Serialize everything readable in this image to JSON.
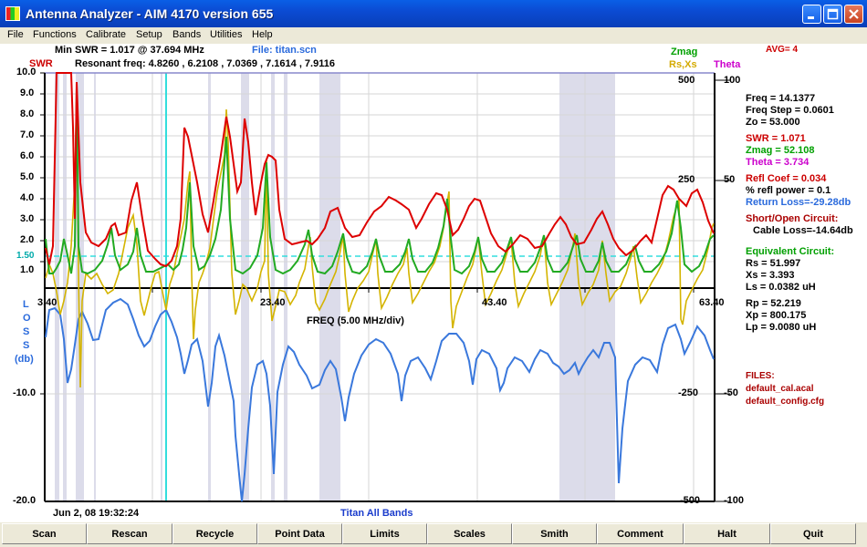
{
  "window": {
    "title": "Antenna Analyzer  -   AIM 4170 version 655"
  },
  "menu": [
    "File",
    "Functions",
    "Calibrate",
    "Setup",
    "Bands",
    "Utilities",
    "Help"
  ],
  "header": {
    "min_swr": "Min SWR =  1.017 @  37.694 MHz",
    "file": "File: titan.scn",
    "resonant": "Resonant freq:  4.8260 , 6.2108 , 7.0369 , 7.1614 , 7.9116",
    "swr_legend": "SWR",
    "zmag_legend": "Zmag",
    "rsxs_legend": "Rs,Xs",
    "theta_legend": "Theta",
    "avg": "AVG=  4"
  },
  "axes": {
    "swr_ticks": [
      "10.0",
      "9.0",
      "8.0",
      "7.0",
      "6.0",
      "5.0",
      "4.0",
      "3.0",
      "2.0",
      "1.50",
      "1.0"
    ],
    "loss_label": [
      "L",
      "O",
      "S",
      "S",
      "(db)"
    ],
    "loss_ticks": [
      "-10.0",
      "-20.0"
    ],
    "x_ticks": [
      "3.40",
      "23.40",
      "43.40",
      "63.40"
    ],
    "x_label": "FREQ (5.00 MHz/div)",
    "zmag_ticks": [
      "500",
      "250",
      "-250",
      "-500"
    ],
    "theta_ticks": [
      "100",
      "50",
      "-50",
      "-100"
    ]
  },
  "footer": {
    "date": "Jun 2, 08   19:32:24",
    "band": "Titan All Bands"
  },
  "panel": {
    "freq": "Freq =  14.1377",
    "freq_step": "Freq Step =  0.0601",
    "zo": "Zo =   53.000",
    "swr": "SWR  =   1.071",
    "zmag": "Zmag =   52.108",
    "theta": "Theta =    3.734",
    "refl_coef": "Refl Coef    = 0.034",
    "refl_power": "% refl power =  0.1",
    "return_loss": "Return Loss=-29.28db",
    "short_open": "Short/Open Circuit:",
    "cable_loss": "Cable Loss=-14.64db",
    "equiv": "Equivalent Circuit:",
    "rs": "Rs =   51.997",
    "xs": "Xs =     3.393",
    "ls": "Ls =    0.0382  uH",
    "rp": "Rp =   52.219",
    "xp": "Xp =  800.175",
    "lp": "Lp =     9.0080  uH",
    "files_title": "FILES:",
    "file1": "default_cal.acal",
    "file2": "default_config.cfg"
  },
  "buttons": [
    "Scan",
    "Rescan",
    "Recycle",
    "Point Data",
    "Limits",
    "Scales",
    "Smith",
    "Comment",
    "Halt",
    "Quit"
  ],
  "colors": {
    "swr": "#dd0000",
    "zmag": "#22aa22",
    "rsxs": "#d4b400",
    "loss": "#3a78dc",
    "marker": "#33dddd"
  }
}
